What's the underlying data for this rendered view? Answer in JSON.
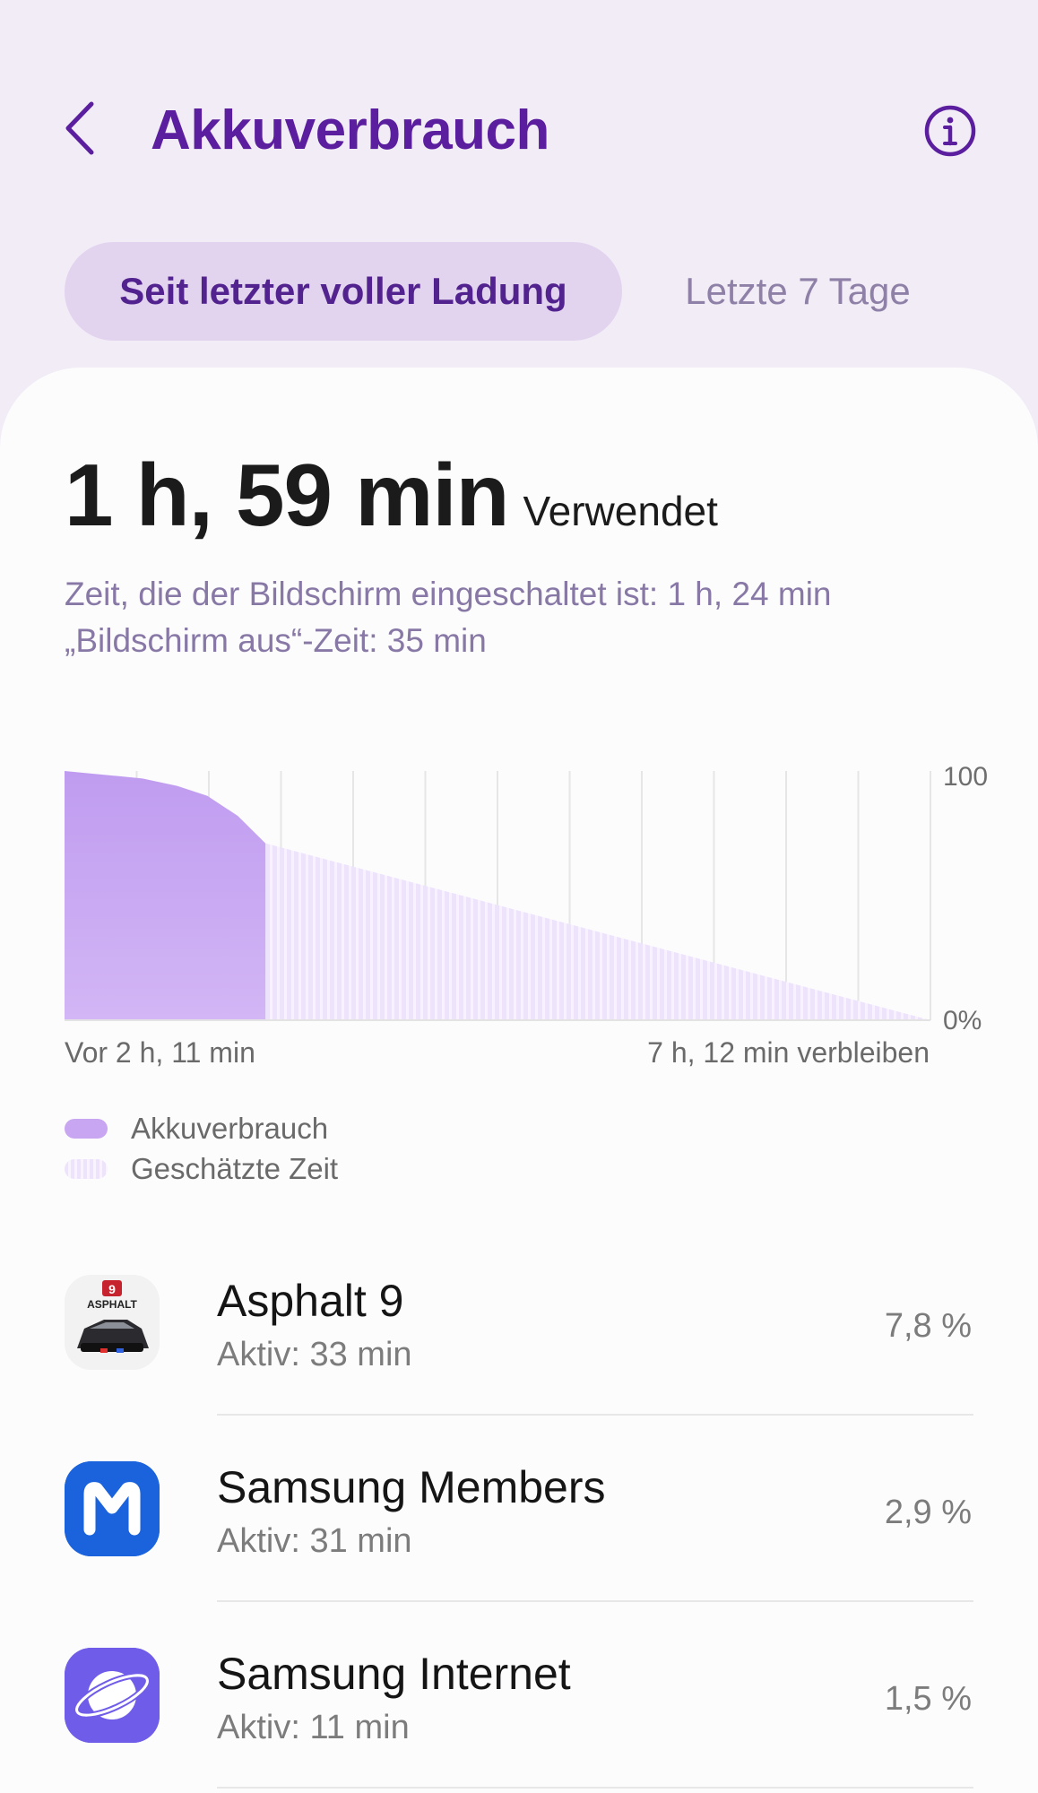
{
  "header": {
    "title": "Akkuverbrauch"
  },
  "tabs": {
    "active": "Seit letzter voller Ladung",
    "inactive": "Letzte 7 Tage"
  },
  "summary": {
    "used_value": "1 h, 59 min",
    "used_label": "Verwendet",
    "screen_on": "Zeit, die der Bildschirm eingeschaltet ist: 1 h, 24 min",
    "screen_off": "„Bildschirm aus“-Zeit: 35 min"
  },
  "chart_data": {
    "type": "area",
    "y_ticks": [
      "100",
      "0%"
    ],
    "x_start_label": "Vor 2 h, 11 min",
    "x_end_label": "7 h, 12 min verbleiben",
    "ylim": [
      0,
      100
    ],
    "grid": true,
    "series": [
      {
        "name": "Akkuverbrauch",
        "x_fraction": [
          0,
          0.06,
          0.09,
          0.13,
          0.165,
          0.2,
          0.232
        ],
        "values": [
          100,
          98,
          97,
          94,
          90,
          82,
          71
        ]
      },
      {
        "name": "Geschätzte Zeit",
        "x_fraction": [
          0.232,
          1.0
        ],
        "values": [
          71,
          0
        ]
      }
    ],
    "colors": {
      "used": "#c8a6f2",
      "estimated": "#ede3fb"
    }
  },
  "legend": {
    "used": "Akkuverbrauch",
    "estimated": "Geschätzte Zeit"
  },
  "apps": [
    {
      "name": "Asphalt 9",
      "sub": "Aktiv: 33 min",
      "percent": "7,8 %",
      "icon": "asphalt-9-icon",
      "icon_text": "ASPHALT",
      "icon_badge": "9"
    },
    {
      "name": "Samsung Members",
      "sub": "Aktiv: 31 min",
      "percent": "2,9 %",
      "icon": "samsung-members-icon",
      "icon_text": "M"
    },
    {
      "name": "Samsung Internet",
      "sub": "Aktiv: 11 min",
      "percent": "1,5 %",
      "icon": "samsung-internet-icon"
    }
  ],
  "colors": {
    "accent": "#5a1e9e",
    "background": "#f1ecf6",
    "card": "#fcfcfd"
  }
}
